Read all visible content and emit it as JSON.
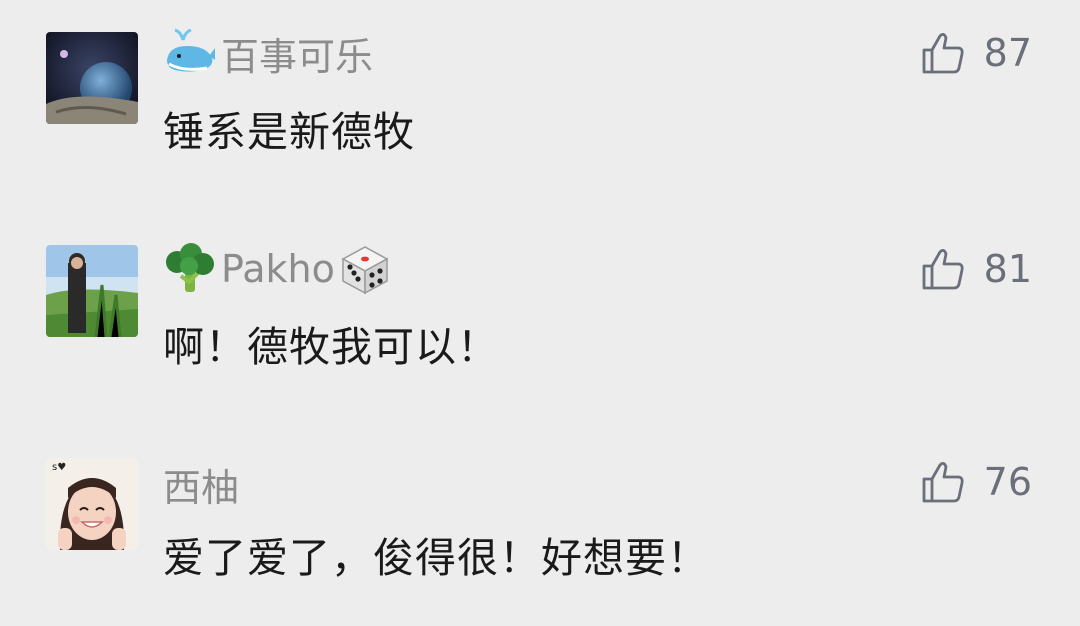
{
  "comments": [
    {
      "username": "百事可乐",
      "name_emoji_icon": "whale-icon",
      "text": "锤系是新德牧",
      "likes": "87"
    },
    {
      "username": "Pakho",
      "name_emoji_icon": "broccoli-icon",
      "name_trailing_icon": "dice-icon",
      "text": "啊！德牧我可以！",
      "likes": "81"
    },
    {
      "username": "西柚",
      "text": "爱了爱了，俊得很！好想要！",
      "likes": "76"
    }
  ],
  "colors": {
    "background": "#ededed",
    "username": "#8c8c8c",
    "text": "#1a1a1a",
    "like": "#6b6f7a"
  }
}
